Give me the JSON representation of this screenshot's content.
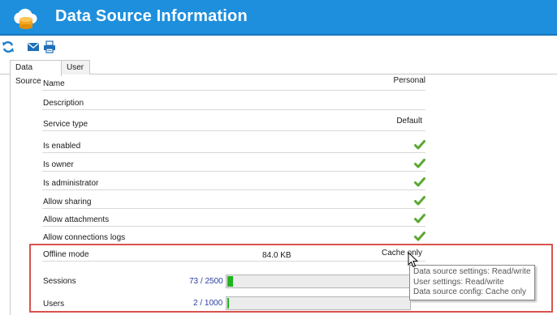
{
  "window": {
    "title": "Data Source Information"
  },
  "toolbar": {
    "buttons": [
      "refresh-icon",
      "email-icon",
      "print-icon"
    ]
  },
  "tabs": [
    {
      "label": "Data Source",
      "active": true
    },
    {
      "label": "User",
      "active": false
    }
  ],
  "fields": {
    "name": {
      "label": "Name",
      "value": "Personal"
    },
    "description": {
      "label": "Description",
      "value": ""
    },
    "service_type": {
      "label": "Service type",
      "value": "Default"
    },
    "is_enabled": {
      "label": "Is enabled",
      "checked": true
    },
    "is_owner": {
      "label": "Is owner",
      "checked": true
    },
    "is_administrator": {
      "label": "Is administrator",
      "checked": true
    },
    "allow_sharing": {
      "label": "Allow sharing",
      "checked": true
    },
    "allow_attachments": {
      "label": "Allow attachments",
      "checked": true
    },
    "allow_connections_logs": {
      "label": "Allow connections logs",
      "checked": true
    },
    "offline_mode": {
      "label": "Offline mode",
      "size": "84.0 KB",
      "value": "Cache only"
    },
    "sessions": {
      "label": "Sessions",
      "count": "73 / 2500",
      "fraction": 0.0292
    },
    "users": {
      "label": "Users",
      "count": "2 / 1000",
      "fraction": 0.002
    }
  },
  "tooltip": {
    "lines": [
      "Data source settings: Read/write",
      "User settings: Read/write",
      "Data source config: Cache only"
    ]
  },
  "colors": {
    "titlebar": "#1e8fdc",
    "check": "#5aa831",
    "progress_fill": "#20b520",
    "highlight": "#d9534f",
    "count_text": "#2b3fa0"
  }
}
